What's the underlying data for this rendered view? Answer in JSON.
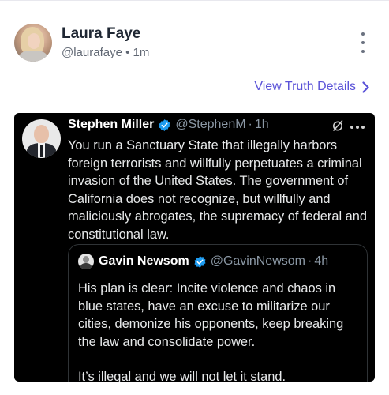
{
  "post": {
    "author_name": "Laura Faye",
    "author_meta": "@laurafaye • 1m",
    "view_details_label": "View Truth Details"
  },
  "tweet": {
    "author_name": "Stephen Miller",
    "handle": "@StephenM",
    "separator": "·",
    "time": "1h",
    "text": "You run a Sanctuary State that illegally harbors foreign terrorists and willfully perpetuates a criminal invasion of the United States. The government of California does not recognize, but willfully and maliciously abrogates, the supremacy of federal and constitutional law.",
    "quote": {
      "author_name": "Gavin Newsom",
      "handle": "@GavinNewsom",
      "separator": "·",
      "time": "4h",
      "paragraph_1": "His plan is clear: Incite violence and chaos in blue states, have an excuse to militarize our cities, demonize his opponents, keep breaking the law and consolidate power.",
      "paragraph_2": "It’s illegal and we will not let it stand."
    }
  },
  "colors": {
    "accent": "#5a52d8",
    "verified": "#1d9bf0",
    "tweet_bg": "#000000"
  },
  "icons": {
    "more": "more-vertical-icon",
    "chevron": "chevron-right-icon",
    "verified": "verified-badge-icon",
    "grok": "grok-icon",
    "tweet_more": "more-horizontal-icon"
  }
}
